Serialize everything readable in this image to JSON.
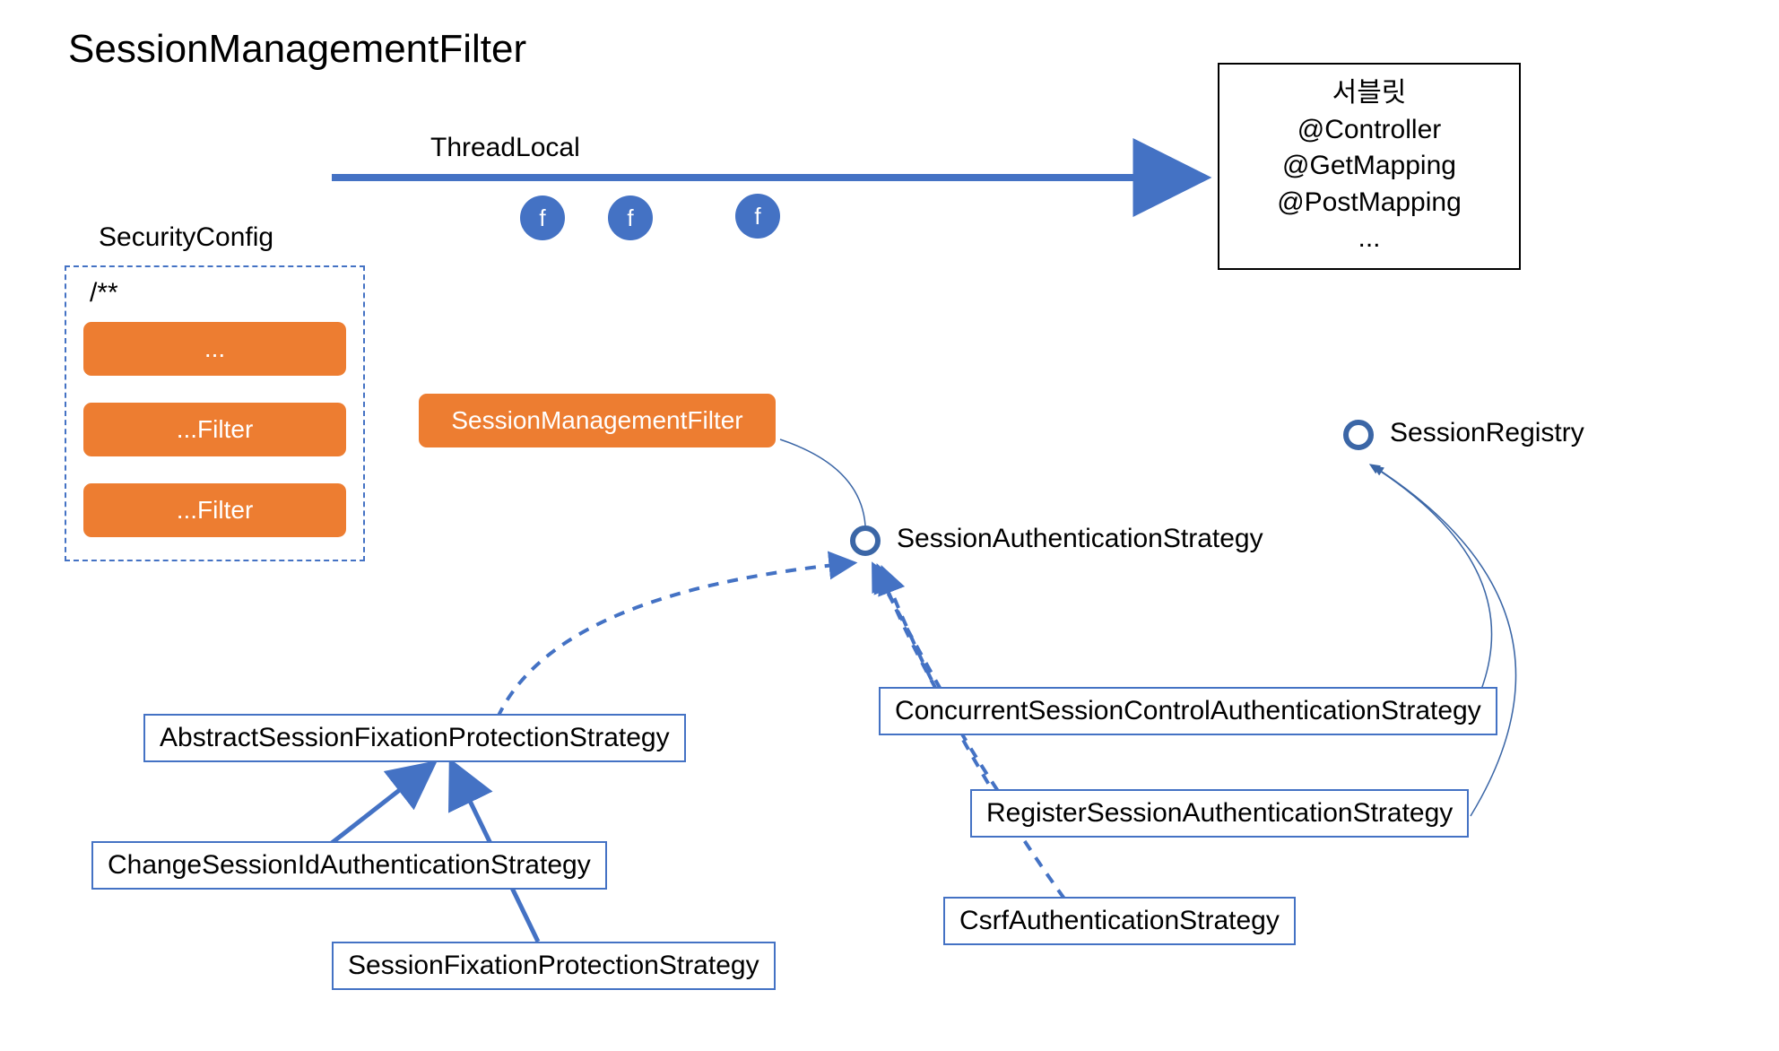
{
  "title": "SessionManagementFilter",
  "threadLocal": "ThreadLocal",
  "securityConfig": {
    "label": "SecurityConfig",
    "pattern": "/**",
    "items": [
      "...",
      "...Filter",
      "...Filter"
    ]
  },
  "filterCircle": "f",
  "sessionFilter": "SessionManagementFilter",
  "sessionAuthStrategy": "SessionAuthenticationStrategy",
  "sessionRegistry": "SessionRegistry",
  "servlet": {
    "line1": "서블릿",
    "line2": "@Controller",
    "line3": "@GetMapping",
    "line4": "@PostMapping",
    "line5": "..."
  },
  "strategies": {
    "abstractFixation": "AbstractSessionFixationProtectionStrategy",
    "changeSessionId": "ChangeSessionIdAuthenticationStrategy",
    "sessionFixation": "SessionFixationProtectionStrategy",
    "concurrent": "ConcurrentSessionControlAuthenticationStrategy",
    "register": "RegisterSessionAuthenticationStrategy",
    "csrf": "CsrfAuthenticationStrategy"
  }
}
